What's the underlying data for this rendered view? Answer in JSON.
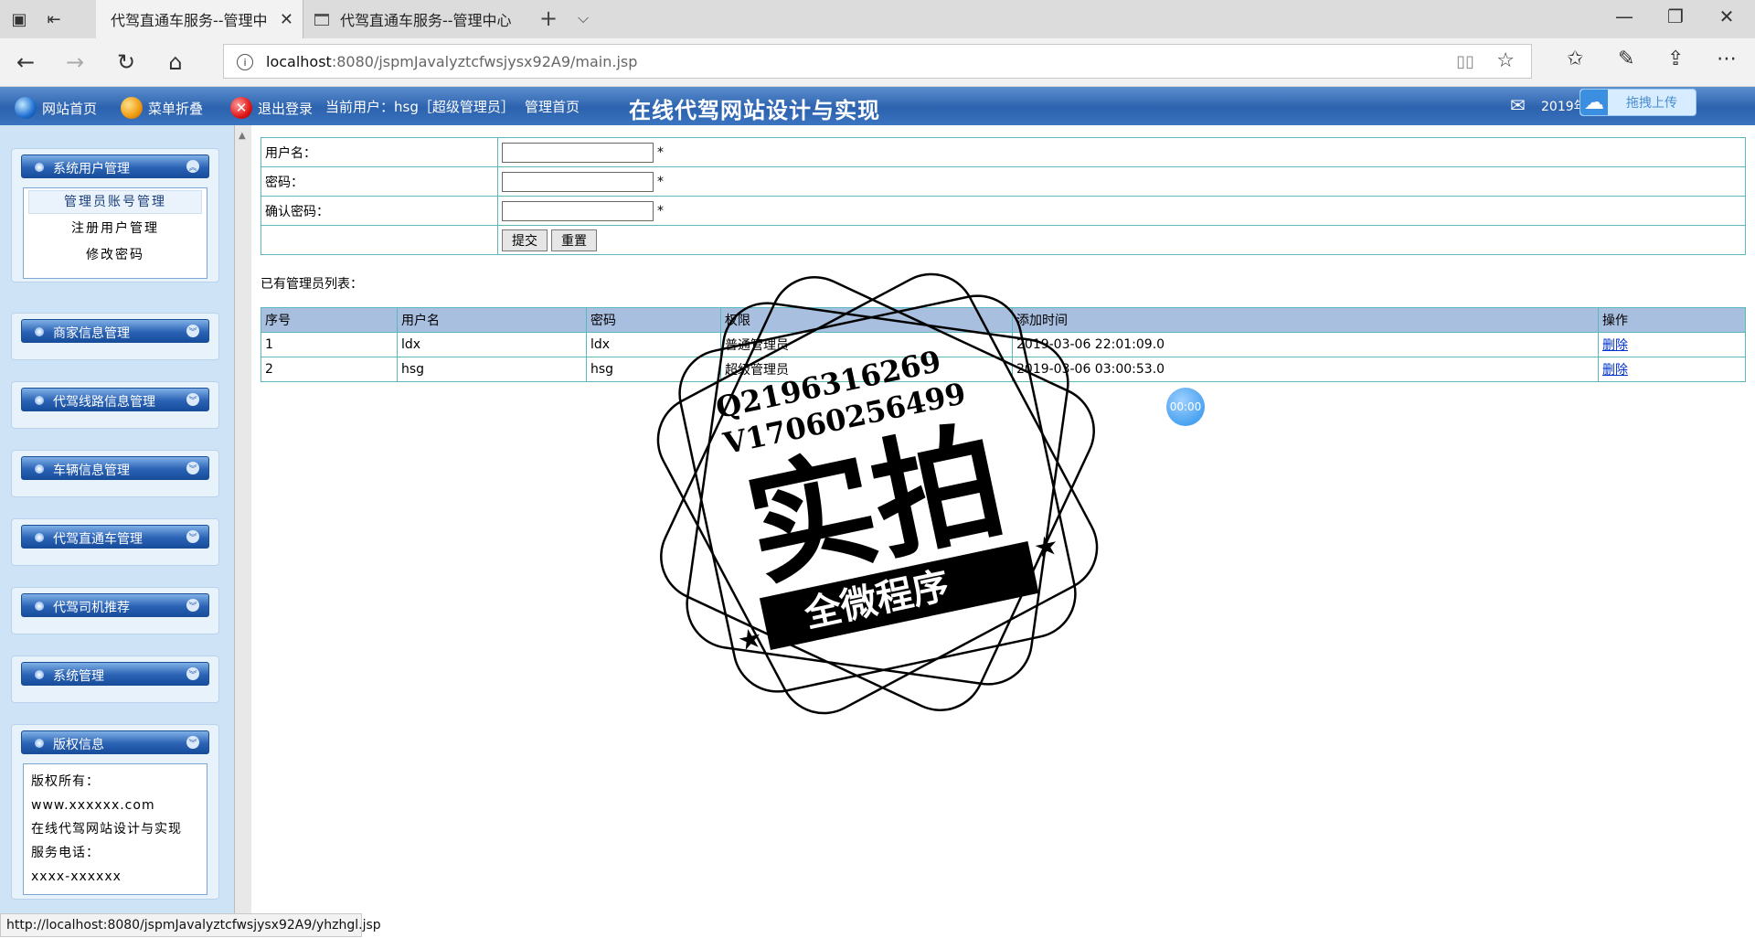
{
  "browser": {
    "tabs": [
      {
        "title": "代驾直通车服务--管理中",
        "active": true
      },
      {
        "title": "代驾直通车服务--管理中心",
        "active": false
      }
    ],
    "url_host": "localhost",
    "url_path": ":8080/jspmJavalyztcfwsjysx92A9/main.jsp",
    "status_url": "http://localhost:8080/jspmJavalyztcfwsjysx92A9/yhzhgl.jsp",
    "icons": {
      "back": "back-arrow-icon",
      "forward": "forward-arrow-icon",
      "refresh": "refresh-icon",
      "home": "home-icon",
      "favorites": "favorites-icon",
      "notes": "pen-icon",
      "share": "share-icon",
      "more": "more-icon"
    }
  },
  "header": {
    "site_home": "网站首页",
    "menu_fold": "菜单折叠",
    "logout": "退出登录",
    "current_user": "当前用户：hsg［超级管理员］",
    "admin_home": "管理首页",
    "title": "在线代驾网站设计与实现",
    "date": "2019年",
    "upload_label": "拖拽上传"
  },
  "sidebar": {
    "panels": [
      {
        "title": "系统用户管理",
        "items": [
          "管理员账号管理",
          "注册用户管理",
          "修改密码"
        ]
      },
      {
        "title": "商家信息管理"
      },
      {
        "title": "代驾线路信息管理"
      },
      {
        "title": "车辆信息管理"
      },
      {
        "title": "代驾直通车管理"
      },
      {
        "title": "代驾司机推荐"
      },
      {
        "title": "系统管理"
      },
      {
        "title": "版权信息",
        "lines": [
          "版权所有：",
          "www.xxxxxx.com",
          "在线代驾网站设计与实现",
          "服务电话：",
          "xxxx-xxxxxx"
        ]
      }
    ]
  },
  "form": {
    "username_label": "用户名：",
    "password_label": "密码：",
    "confirm_label": "确认密码：",
    "required_mark": "*",
    "submit": "提交",
    "reset": "重置"
  },
  "list": {
    "title": "已有管理员列表：",
    "columns": [
      "序号",
      "用户名",
      "密码",
      "权限",
      "添加时间",
      "操作"
    ],
    "rows": [
      {
        "no": "1",
        "username": "ldx",
        "password": "ldx",
        "role": "普通管理员",
        "time": "2019-03-06 22:01:09.0",
        "action": "删除"
      },
      {
        "no": "2",
        "username": "hsg",
        "password": "hsg",
        "role": "超级管理员",
        "time": "2019-03-06 03:00:53.0",
        "action": "删除"
      }
    ]
  },
  "overlay": {
    "timer": "00:00",
    "watermark_lines": [
      "Q2196316269",
      "V17060256499",
      "实拍",
      "全微程序"
    ]
  }
}
